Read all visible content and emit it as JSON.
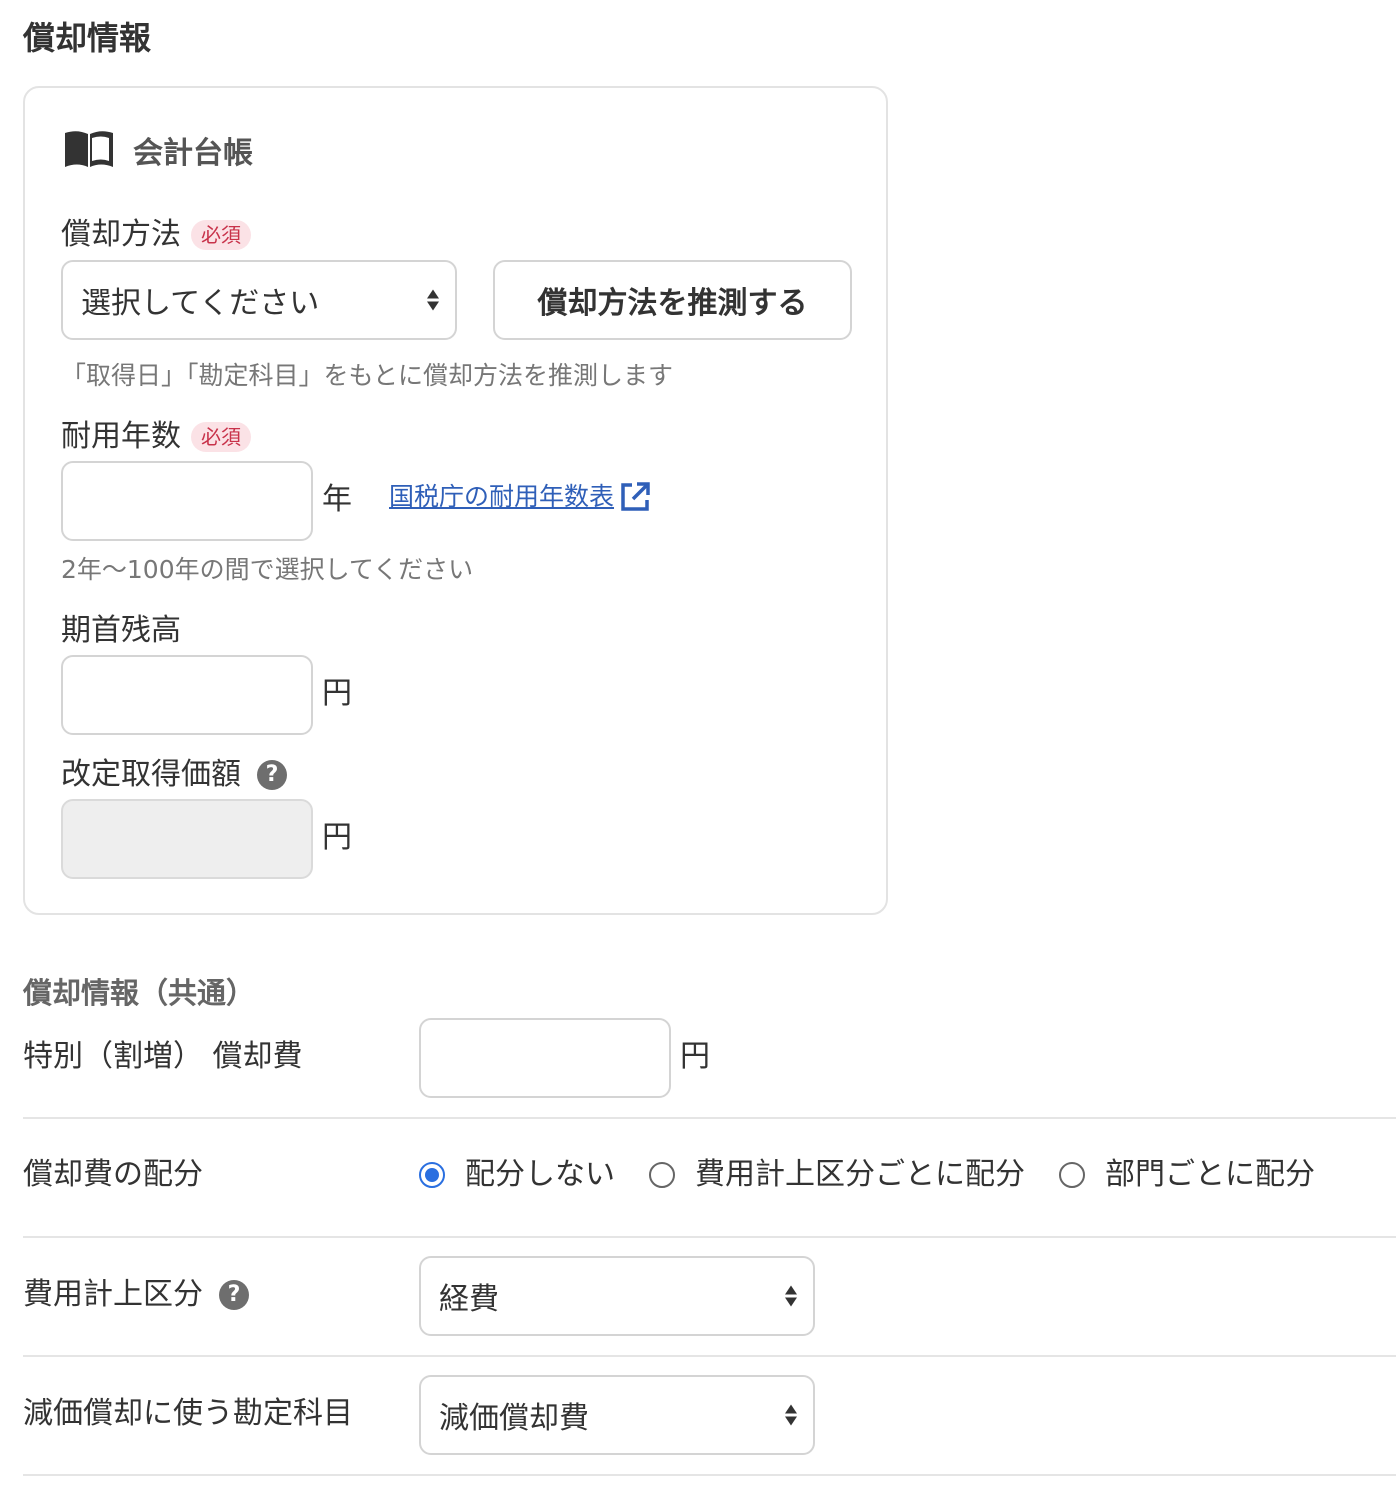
{
  "page_title": "償却情報",
  "ledger_card": {
    "title": "会計台帳",
    "icon": "book-icon",
    "method": {
      "label": "償却方法",
      "required_badge": "必須",
      "select_value": "選択してください",
      "infer_button": "償却方法を推測する",
      "help": "「取得日」「勘定科目」をもとに償却方法を推測します"
    },
    "useful_life": {
      "label": "耐用年数",
      "required_badge": "必須",
      "value": "",
      "unit": "年",
      "link_text": "国税庁の耐用年数表",
      "help": "2年〜100年の間で選択してください"
    },
    "opening_balance": {
      "label": "期首残高",
      "value": "",
      "unit": "円"
    },
    "revised_cost": {
      "label": "改定取得価額",
      "value": "",
      "unit": "円"
    }
  },
  "common": {
    "title": "償却情報（共通）",
    "special_depreciation": {
      "label": "特別（割増） 償却費",
      "value": "",
      "unit": "円"
    },
    "allocation": {
      "label": "償却費の配分",
      "options": [
        "配分しない",
        "費用計上区分ごとに配分",
        "部門ごとに配分"
      ],
      "selected": "配分しない"
    },
    "expense_category": {
      "label": "費用計上区分",
      "value": "経費"
    },
    "account": {
      "label": "減価償却に使う勘定科目",
      "value": "減価償却費"
    }
  },
  "colors": {
    "accent": "#2a6fe0",
    "link": "#2f5fb8",
    "required_text": "#c8324a",
    "required_bg": "#fbe2e6"
  }
}
